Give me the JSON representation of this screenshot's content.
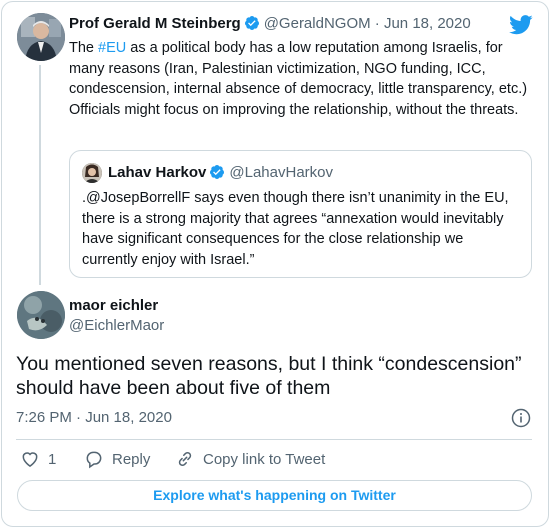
{
  "parent_tweet": {
    "author_name": "Prof Gerald M Steinberg",
    "author_handle": "@GeraldNGOM",
    "separator": "·",
    "date": "Jun 18, 2020",
    "text_pre": "The ",
    "hashtag": "#EU",
    "text_post": " as a political body has a low reputation among Israelis, for many reasons (Iran, Palestinian victimization, NGO funding, ICC, condescension, internal absence of democracy, little transparency, etc.) Officials might focus on improving the relationship, without the threats."
  },
  "quoted_tweet": {
    "author_name": "Lahav Harkov",
    "author_handle": "@LahavHarkov",
    "text": ".@JosepBorrellF says even though there isn’t unanimity in the EU,  there is a strong majority that agrees “annexation would inevitably have significant consequences for the close relationship we currently enjoy with Israel.”"
  },
  "reply_tweet": {
    "author_name": "maor eichler",
    "author_handle": "@EichlerMaor",
    "text": "You mentioned seven reasons, but I think “condescension” should have been about five of them",
    "timestamp": "7:26 PM · Jun 18, 2020"
  },
  "actions": {
    "like_count": "1",
    "reply_label": "Reply",
    "copy_link_label": "Copy link to Tweet"
  },
  "explore_label": "Explore what's happening on Twitter",
  "icons": {
    "brand": "twitter-bird-icon",
    "verified": "verified-badge-icon",
    "info": "info-icon",
    "like": "heart-icon",
    "reply": "speech-bubble-icon",
    "copy": "link-icon"
  },
  "colors": {
    "accent": "#1d9bf0",
    "text": "#0f1419",
    "muted": "#536471",
    "border": "#cfd9de"
  }
}
